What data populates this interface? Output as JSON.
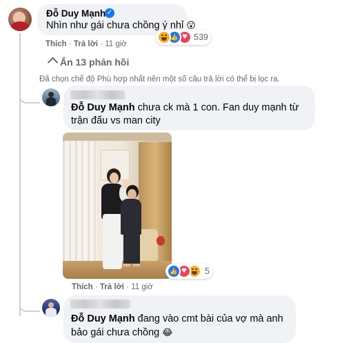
{
  "comment1": {
    "author": "Đỗ Duy Mạnh",
    "text": "Nhìn như gái chưa chồng ý nhỉ",
    "emoji": "😮",
    "reaction_count": "539",
    "like_label": "Thích",
    "reply_label": "Trả lời",
    "time": "11 giờ"
  },
  "hide_replies": {
    "label": "Ẩn 13 phản hồi"
  },
  "filter_notice": "Đã chọn chế độ Phù hợp nhất nên một số câu trả lời có thể bị lọc ra.",
  "reply1": {
    "author": "Đỗ Duy Mạnh",
    "text_line1": "chưa ck mà 1 con. Fan duy mạnh từ",
    "text_line2": "trận đấu vs man city",
    "reaction_count": "5",
    "like_label": "Thích",
    "reply_label": "Trả lời",
    "time": "11 giờ"
  },
  "reply2": {
    "author": "Đỗ Duy Mạnh",
    "text_line1": "đang vào cmt bài của vợ mà anh",
    "text_line2": "bảo gái chưa chồng",
    "emoji": "😂"
  },
  "colors": {
    "like_blue": "#1877f2",
    "love_red": "#f33e58",
    "haha_yellow": "#f7b125",
    "meta_gray": "#65676b",
    "bubble_gray": "#f0f2f5"
  }
}
